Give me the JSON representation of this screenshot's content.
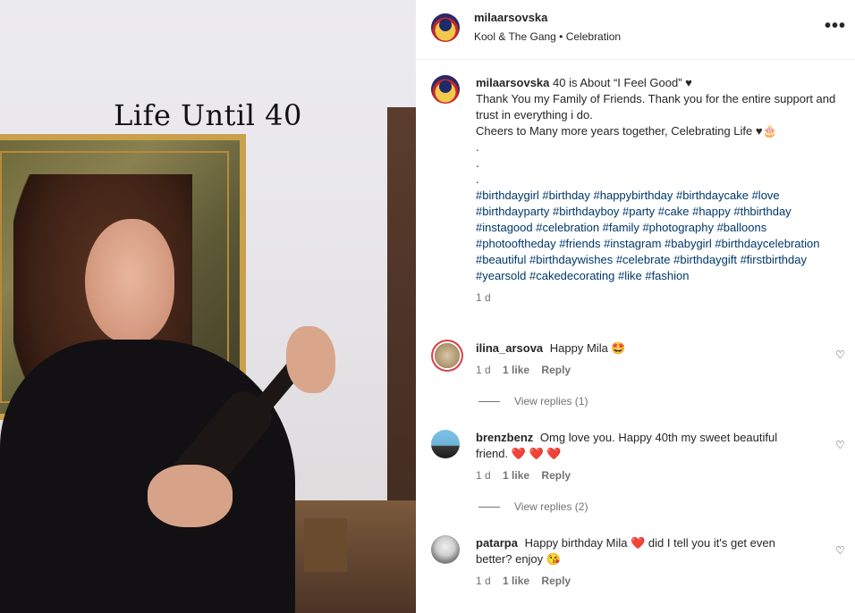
{
  "media": {
    "overlay_text": "Life Until 40"
  },
  "header": {
    "username": "milaarsovska",
    "subtitle": "Kool & The Gang • Celebration",
    "more_label": "•••"
  },
  "caption": {
    "username": "milaarsovska",
    "line1": "40 is About “I Feel Good” ♥",
    "line2": "Thank You my Family of Friends. Thank you for the entire support and trust in everything i do.",
    "line3": "Cheers to Many more years together, Celebrating Life ♥🎂",
    "dots": [
      ".",
      ".",
      "."
    ],
    "hashtags": "#birthdaygirl #birthday #happybirthday #birthdaycake #love #birthdayparty #birthdayboy #party #cake #happy #thbirthday #instagood #celebration #family #photography #balloons #photooftheday #friends #instagram #babygirl #birthdaycelebration #beautiful #birthdaywishes #celebrate #birthdaygift #firstbirthday #yearsold #cakedecorating #like #fashion",
    "time": "1 d"
  },
  "comments": [
    {
      "username": "ilina_arsova",
      "text": "Happy Mila 🤩",
      "time": "1 d",
      "likes": "1 like",
      "reply": "Reply",
      "view_replies": "View replies (1)"
    },
    {
      "username": "brenzbenz",
      "text": "Omg love you. Happy 40th my sweet beautiful friend. ❤️ ❤️ ❤️",
      "time": "1 d",
      "likes": "1 like",
      "reply": "Reply",
      "view_replies": "View replies (2)"
    },
    {
      "username": "patarpa",
      "text": "Happy birthday Mila ❤️  did I tell you it's get even better? enjoy 😘",
      "time": "1 d",
      "likes": "1 like",
      "reply": "Reply"
    }
  ],
  "icons": {
    "heart": "♡"
  }
}
